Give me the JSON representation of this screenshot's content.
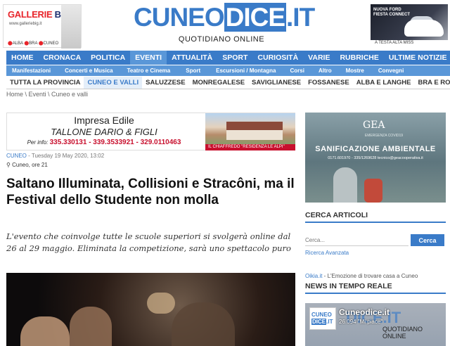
{
  "header": {
    "ad_left": {
      "brand_red": "GALLERIE",
      "brand_blue": " BIG",
      "url": "www.galleriebig.it",
      "locations": [
        "ALBA",
        "BRA",
        "CUNEO"
      ]
    },
    "logo_part1": "CUNEO",
    "logo_part2": "DICE",
    "logo_part3": ".IT",
    "tagline": "QUOTIDIANO ONLINE",
    "ad_right": {
      "line1": "NUOVA FORD FIESTA CONNECT",
      "line2": "A TESTA ALTA MISS"
    }
  },
  "main_nav": [
    "HOME",
    "CRONACA",
    "POLITICA",
    "EVENTI",
    "ATTUALITÀ",
    "SPORT",
    "CURIOSITÀ",
    "VARIE",
    "RUBRICHE",
    "ULTIME NOTIZIE"
  ],
  "main_nav_active": "EVENTI",
  "sub_nav": [
    "Manifestazioni",
    "Concerti e Musica",
    "Teatro e Cinema",
    "Sport",
    "Escursioni / Montagna",
    "Corsi",
    "Altro",
    "Mostre",
    "Convegni"
  ],
  "zone_nav": [
    "TUTTA LA PROVINCIA",
    "CUNEO E VALLI",
    "SALUZZESE",
    "MONREGALESE",
    "SAVIGLIANESE",
    "FOSSANESE",
    "ALBA E LANGHE",
    "BRA E ROERO"
  ],
  "zone_active": "CUNEO E VALLI",
  "breadcrumb": "Home \\ Eventi \\ Cuneo e valli",
  "banner": {
    "line1": "Impresa Edile",
    "line2": "TALLONE DARIO & FIGLI",
    "info_label": "Per info: ",
    "phones": "335.330131 - 339.3533921 - 329.0110463",
    "footer": "IL CHIAFFREDO \"RESIDENZA LE ALPI\""
  },
  "article": {
    "category": "CUNEO",
    "date": " - Tuesday 19 May 2020, 13:02",
    "place": "Cuneo, ore 21",
    "headline": "Saltano Illuminata, Collisioni e Stracôni, ma il Festival dello Studente non molla",
    "lead": "L'evento che coinvolge tutte le scuole superiori si svolgerà online dal 26 al 29 maggio. Eliminata la competizione, sarà uno spettacolo puro"
  },
  "sidebar": {
    "ad": {
      "brand": "GEA",
      "small": "EMERGENZA COVID19",
      "title": "SANIFICAZIONE AMBIENTALE",
      "contacts": "0171.601970 - 335/1269628     tecnico@geacooperativa.it"
    },
    "search_title": "CERCA ARTICOLI",
    "search_placeholder": "Cerca...",
    "search_button": "Cerca",
    "advanced_search": "Ricerca Avanzata",
    "oikia_link": "Oikia.it",
    "oikia_text": " - L'Emozione di trovare casa a Cuneo",
    "news_title": "NEWS IN TEMPO REALE",
    "fb": {
      "name": "Cuneodice.it",
      "likes": "26.094 \"Mi piace\"",
      "tagline": "QUOTIDIANO ONLINE"
    }
  },
  "colors": {
    "accent": "#3a7bc8",
    "sub_accent": "#5a97d8",
    "red": "#c8102e"
  }
}
